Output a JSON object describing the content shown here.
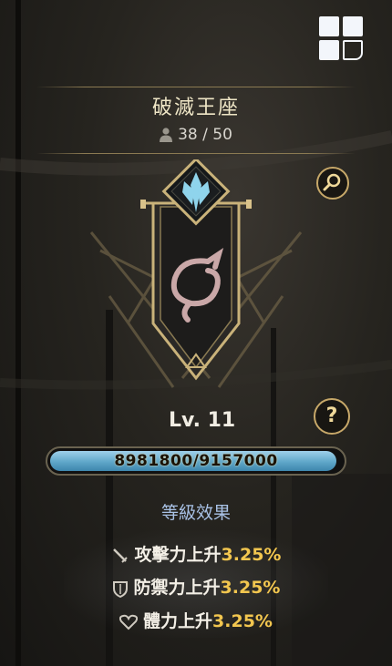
{
  "guild": {
    "name": "破滅王座",
    "members": "38 / 50",
    "level": "Lv. 11"
  },
  "experience": {
    "label": "8981800/9157000",
    "fraction": 0.981
  },
  "effects": {
    "title": "等級效果",
    "items": [
      {
        "icon": "sword-icon",
        "label": "攻擊力上升",
        "value": "3.25%"
      },
      {
        "icon": "shield-icon",
        "label": "防禦力上升",
        "value": "3.25%"
      },
      {
        "icon": "heart-icon",
        "label": "體力上升",
        "value": "3.25%"
      }
    ]
  },
  "buttons": {
    "help_label": "?"
  },
  "colors": {
    "accent_gold": "#c7a869",
    "exp_bar": "#5fa7c9",
    "effect_value": "#f2c64f",
    "title_blue": "#a9c2e6"
  }
}
